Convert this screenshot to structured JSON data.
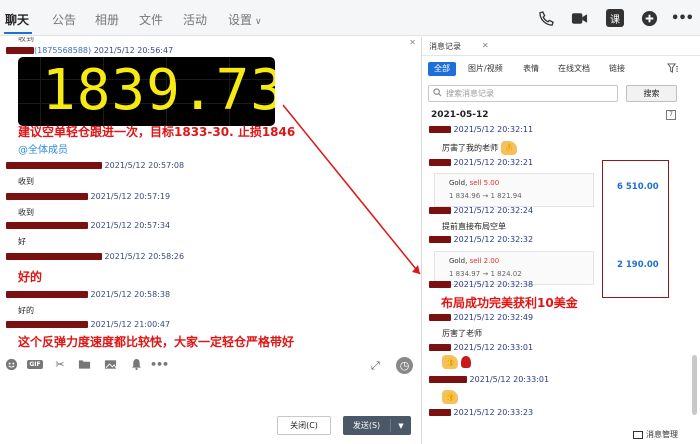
{
  "tabs": [
    {
      "label": "聊天",
      "active": true
    },
    {
      "label": "公告",
      "active": false
    },
    {
      "label": "相册",
      "active": false
    },
    {
      "label": "文件",
      "active": false
    },
    {
      "label": "活动",
      "active": false
    },
    {
      "label": "设置",
      "active": false
    }
  ],
  "top_icons": [
    "phone-icon",
    "video-icon",
    "course-icon",
    "plus-icon",
    "more-icon"
  ],
  "course_label": "课",
  "chat": {
    "messages": [
      {
        "phone": "(1875568588)",
        "time": "2021/5/12 20:56:47"
      },
      {
        "time": "2021/5/12 20:57:08",
        "text": "收到"
      },
      {
        "time": "2021/5/12 20:57:19",
        "text": "收到"
      },
      {
        "time": "2021/5/12 20:57:34",
        "text": "好"
      },
      {
        "time": "2021/5/12 20:58:26",
        "big_text": "好的"
      },
      {
        "time": "2021/5/12 20:58:38",
        "text": "好的"
      },
      {
        "time": "2021/5/12 21:00:47",
        "big_text": "这个反弹力度速度都比较快，大家一定轻仓严格带好"
      }
    ],
    "price_display": "1839.73",
    "advice": "建议空单轻仓跟进一次，目标1833-30. 止损1846",
    "mention": "@全体成员",
    "top_cut_text": "收到"
  },
  "buttons": {
    "close": "关闭(C)",
    "send": "发送(S)"
  },
  "history": {
    "title": "消息记录",
    "filters": [
      "全部",
      "图片/视频",
      "表情",
      "在线文档",
      "链接"
    ],
    "search_placeholder": "搜索消息记录",
    "search_button": "搜索",
    "date": "2021-05-12",
    "entries": [
      {
        "time": "2021/5/12 20:32:11",
        "text": "厉害了我的老师"
      },
      {
        "time": "2021/5/12 20:32:21"
      },
      {
        "time": "2021/5/12 20:32:24",
        "text": "提前直接布局空单"
      },
      {
        "time": "2021/5/12 20:32:32"
      },
      {
        "time": "2021/5/12 20:32:38"
      },
      {
        "time": "2021/5/12 20:32:49",
        "text": "厉害了老师"
      },
      {
        "time": "2021/5/12 20:33:01"
      },
      {
        "time": "2021/5/12 20:33:01"
      },
      {
        "time": "2021/5/12 20:33:23"
      }
    ],
    "trades": [
      {
        "symbol": "Gold,",
        "side": "sell 5.00",
        "prices": "1 834.96 → 1 821.94",
        "amount": "6 510.00"
      },
      {
        "symbol": "Gold,",
        "side": "sell 2.00",
        "prices": "1 834.97 → 1 824.02",
        "amount": "2 190.00"
      }
    ],
    "profit_note": "布局成功完美获利10美金",
    "manage": "消息管理"
  }
}
